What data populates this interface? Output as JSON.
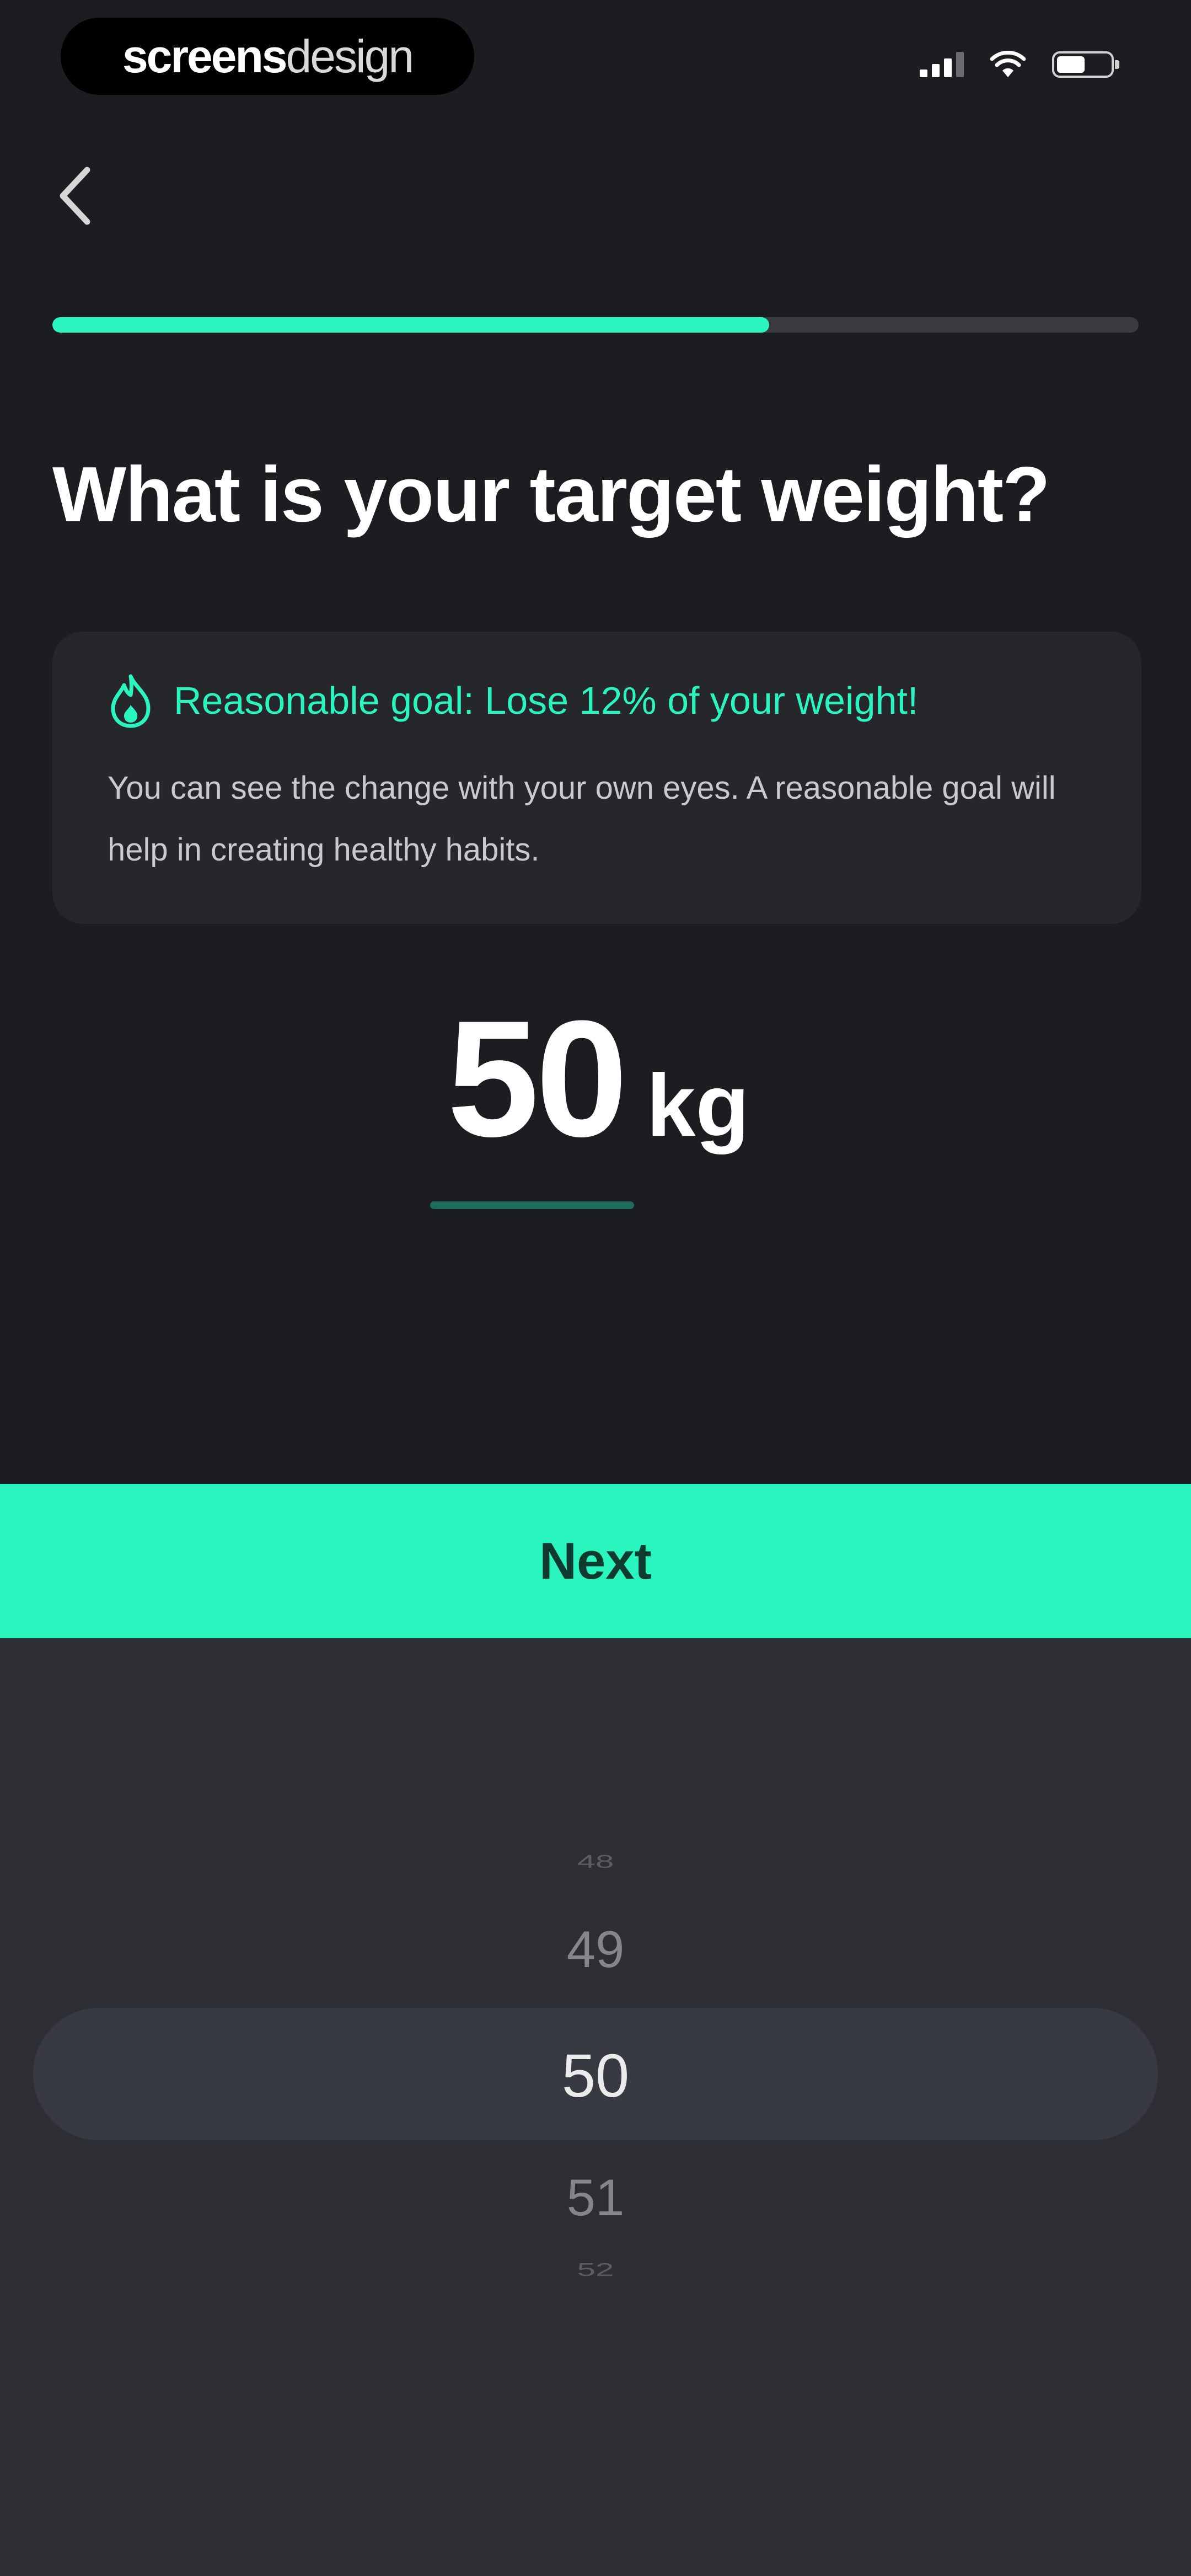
{
  "status_bar": {
    "brand_strong": "screens",
    "brand_light": "design"
  },
  "icons": {
    "back": "chevron-left-icon",
    "goal": "flame-icon",
    "signal": "signal-icon",
    "wifi": "wifi-icon",
    "battery": "battery-icon"
  },
  "colors": {
    "accent": "#2af5bf",
    "background": "#1c1d21",
    "card": "#26272b",
    "picker_panel": "#2d2f35"
  },
  "progress": {
    "fraction": 0.66
  },
  "page": {
    "title": "What is your target weight?"
  },
  "goal_card": {
    "title": "Reasonable goal: Lose 12% of your weight!",
    "description": "You can see the change with your own eyes. A reasonable goal will help in creating healthy habits."
  },
  "weight": {
    "value": "50",
    "unit": "kg"
  },
  "next_button": {
    "label": "Next"
  },
  "picker": {
    "items": [
      "48",
      "49",
      "50",
      "51",
      "52"
    ],
    "selected": "50"
  }
}
